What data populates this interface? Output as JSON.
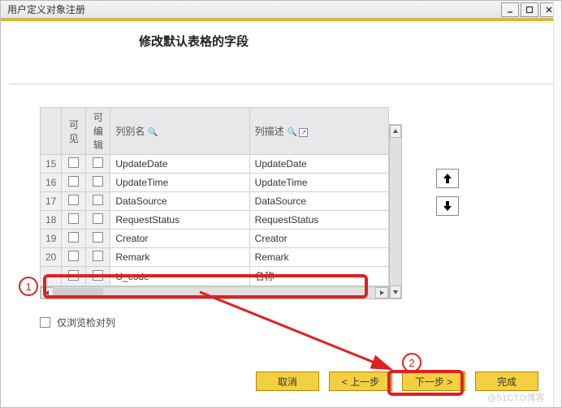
{
  "window": {
    "title": "用户定义对象注册"
  },
  "page": {
    "heading": "修改默认表格的字段"
  },
  "columns": {
    "visible": "可见",
    "editable": "可编辑",
    "alias": "列别名",
    "desc": "列描述"
  },
  "rows": [
    {
      "num": "15",
      "alias": "UpdateDate",
      "desc": "UpdateDate"
    },
    {
      "num": "16",
      "alias": "UpdateTime",
      "desc": "UpdateTime"
    },
    {
      "num": "17",
      "alias": "DataSource",
      "desc": "DataSource"
    },
    {
      "num": "18",
      "alias": "RequestStatus",
      "desc": "RequestStatus"
    },
    {
      "num": "19",
      "alias": "Creator",
      "desc": "Creator"
    },
    {
      "num": "20",
      "alias": "Remark",
      "desc": "Remark"
    },
    {
      "num": "",
      "alias": "U_code",
      "desc": "名称"
    }
  ],
  "browseOnly": "仅浏览检对列",
  "buttons": {
    "cancel": "取消",
    "prev": "< 上一步",
    "next": "下一步 >",
    "finish": "完成"
  },
  "annotations": {
    "label1": "1",
    "label2": "2"
  },
  "watermark": "@51CTO博客"
}
